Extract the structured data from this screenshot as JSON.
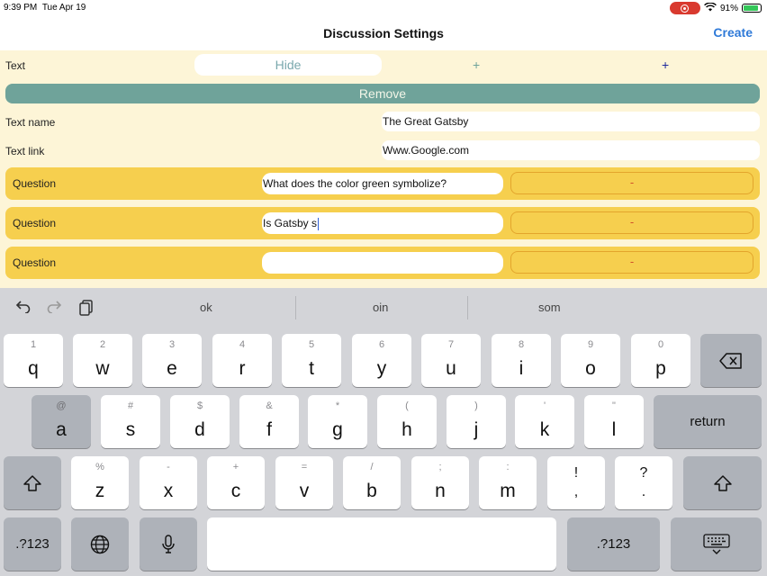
{
  "status_bar": {
    "time": "9:39 PM",
    "date": "Tue Apr 19",
    "battery": "91%"
  },
  "nav": {
    "title": "Discussion Settings",
    "action": "Create"
  },
  "text_row": {
    "label": "Text",
    "hide_label": "Hide",
    "plus_1": "+",
    "plus_2": "+"
  },
  "remove_label": "Remove",
  "text_name": {
    "label": "Text name",
    "value": "The Great Gatsby"
  },
  "text_link": {
    "label": "Text link",
    "value": "Www.Google.com"
  },
  "questions": [
    {
      "label": "Question",
      "value": "What does the color green symbolize?",
      "remove": "-"
    },
    {
      "label": "Question",
      "value": "Is Gatsby s",
      "remove": "-"
    },
    {
      "label": "Question",
      "value": "",
      "remove": "-"
    }
  ],
  "keyboard": {
    "suggestions": [
      "ok",
      "oin",
      "som"
    ],
    "row1": [
      {
        "main": "q",
        "alt": "1"
      },
      {
        "main": "w",
        "alt": "2"
      },
      {
        "main": "e",
        "alt": "3"
      },
      {
        "main": "r",
        "alt": "4"
      },
      {
        "main": "t",
        "alt": "5"
      },
      {
        "main": "y",
        "alt": "6"
      },
      {
        "main": "u",
        "alt": "7"
      },
      {
        "main": "i",
        "alt": "8"
      },
      {
        "main": "o",
        "alt": "9"
      },
      {
        "main": "p",
        "alt": "0"
      }
    ],
    "row2": [
      {
        "main": "a",
        "alt": "@"
      },
      {
        "main": "s",
        "alt": "#"
      },
      {
        "main": "d",
        "alt": "$"
      },
      {
        "main": "f",
        "alt": "&"
      },
      {
        "main": "g",
        "alt": "*"
      },
      {
        "main": "h",
        "alt": "("
      },
      {
        "main": "j",
        "alt": ")"
      },
      {
        "main": "k",
        "alt": "'"
      },
      {
        "main": "l",
        "alt": "\""
      }
    ],
    "row3": [
      {
        "main": "z",
        "alt": "%"
      },
      {
        "main": "x",
        "alt": "-"
      },
      {
        "main": "c",
        "alt": "+"
      },
      {
        "main": "v",
        "alt": "="
      },
      {
        "main": "b",
        "alt": "/"
      },
      {
        "main": "n",
        "alt": ";"
      },
      {
        "main": "m",
        "alt": ":"
      },
      {
        "main": ",",
        "alt": "!"
      },
      {
        "main": ".",
        "alt": "?"
      }
    ],
    "return_label": "return",
    "numbers_label": ".?123"
  }
}
